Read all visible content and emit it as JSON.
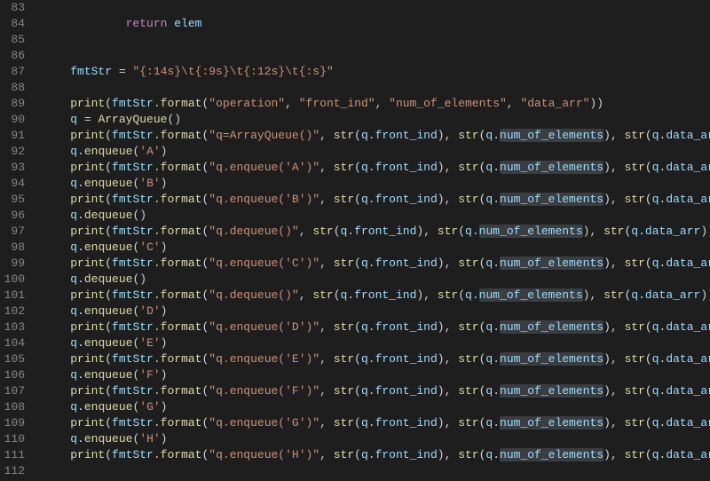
{
  "gutter": {
    "start": 83,
    "end": 112
  },
  "code": {
    "l83": "",
    "l84_kw": "return",
    "l84_var": "elem",
    "l85": "",
    "l86": "",
    "l87_var": "fmtStr",
    "l87_eq": " = ",
    "l87_str": "\"{:14s}\\t{:9s}\\t{:12s}\\t{:s}\"",
    "l88": "",
    "l89_print": "print",
    "l89_fmt": "fmtStr",
    "l89_format": "format",
    "l89_a1": "\"operation\"",
    "l89_a2": "\"front_ind\"",
    "l89_a3": "\"num_of_elements\"",
    "l89_a4": "\"data_arr\"",
    "l90_q": "q",
    "l90_eq": " = ",
    "l90_cls": "ArrayQueue",
    "prn_label_91": "\"q=ArrayQueue()\"",
    "l92_call": "q.enqueue(",
    "l92_arg": "'A'",
    "prn_label_93": "\"q.enqueue('A')\"",
    "l94_call": "q.enqueue(",
    "l94_arg": "'B'",
    "prn_label_95": "\"q.enqueue('B')\"",
    "l96_call": "q.dequeue()",
    "prn_label_97": "\"q.dequeue()\"",
    "l98_call": "q.enqueue(",
    "l98_arg": "'C'",
    "prn_label_99": "\"q.enqueue('C')\"",
    "l100_call": "q.dequeue()",
    "prn_label_101": "\"q.dequeue()\"",
    "l102_call": "q.enqueue(",
    "l102_arg": "'D'",
    "prn_label_103": "\"q.enqueue('D')\"",
    "l104_call": "q.enqueue(",
    "l104_arg": "'E'",
    "prn_label_105": "\"q.enqueue('E')\"",
    "l106_call": "q.enqueue(",
    "l106_arg": "'F'",
    "prn_label_107": "\"q.enqueue('F')\"",
    "l108_call": "q.enqueue(",
    "l108_arg": "'G'",
    "prn_label_109": "\"q.enqueue('G')\"",
    "l110_call": "q.enqueue(",
    "l110_arg": "'H'",
    "prn_label_111": "\"q.enqueue('H')\"",
    "common": {
      "print": "print",
      "fmtStr": "fmtStr",
      "format": "format",
      "str": "str",
      "q": "q",
      "front_ind": "front_ind",
      "num_of_elements": "num_of_elements",
      "data_arr": "data_arr"
    }
  }
}
